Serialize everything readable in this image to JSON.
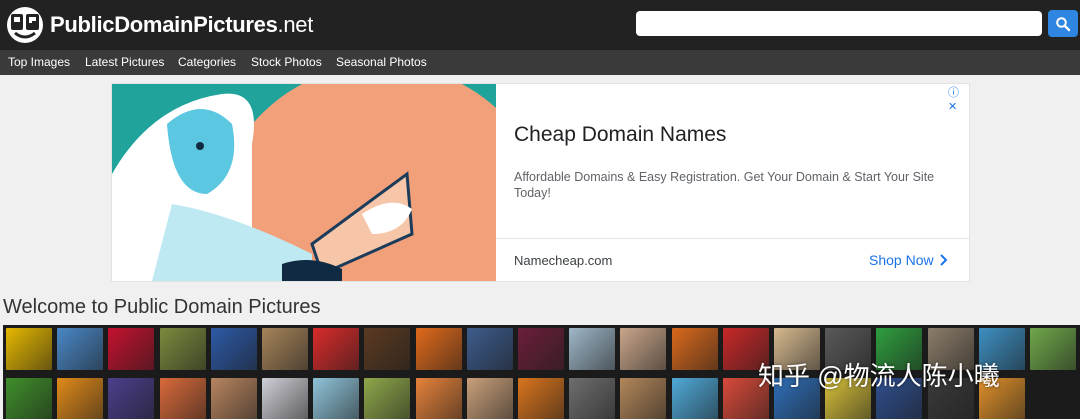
{
  "header": {
    "logo_text": "PublicDomainPictures",
    "logo_tld": ".net",
    "search_placeholder": "",
    "search_icon": "magnifier-icon"
  },
  "nav": {
    "items": [
      {
        "label": "Top Images"
      },
      {
        "label": "Latest Pictures"
      },
      {
        "label": "Categories"
      },
      {
        "label": "Stock Photos"
      },
      {
        "label": "Seasonal Photos"
      }
    ]
  },
  "ad": {
    "title": "Cheap Domain Names",
    "description": "Affordable Domains & Easy Registration. Get Your Domain & Start Your Site Today!",
    "domain": "Namecheap.com",
    "cta": "Shop Now",
    "adchoices": "ⓘ ✕"
  },
  "main": {
    "heading": "Welcome to Public Domain Pictures"
  },
  "thumbnails": [
    {
      "name": "thumb-sunburst",
      "color": "#e6b800"
    },
    {
      "name": "thumb-eye",
      "color": "#4a88c7"
    },
    {
      "name": "thumb-red-flower",
      "color": "#c4122f"
    },
    {
      "name": "thumb-giraffe",
      "color": "#7a8b3d"
    },
    {
      "name": "thumb-wind-turbine",
      "color": "#2d5aa6"
    },
    {
      "name": "thumb-wood-texture",
      "color": "#a6845a"
    },
    {
      "name": "thumb-santa-girl",
      "color": "#d92b2b"
    },
    {
      "name": "thumb-coffee-beans",
      "color": "#5b3a22"
    },
    {
      "name": "thumb-ornament",
      "color": "#e06a1b"
    },
    {
      "name": "thumb-tower-bridge",
      "color": "#3d5c8c"
    },
    {
      "name": "thumb-berries",
      "color": "#6b1f3a"
    },
    {
      "name": "thumb-ice",
      "color": "#9fb7c8"
    },
    {
      "name": "thumb-family",
      "color": "#c9a68a"
    },
    {
      "name": "thumb-butterfly",
      "color": "#d9691c"
    },
    {
      "name": "thumb-red-tulips",
      "color": "#c82828"
    },
    {
      "name": "thumb-sand",
      "color": "#d6b98f"
    },
    {
      "name": "thumb-moon",
      "color": "#5a5a5a"
    },
    {
      "name": "thumb-green-figure",
      "color": "#2f9e3e"
    },
    {
      "name": "thumb-stone-wall",
      "color": "#8c7d6a"
    },
    {
      "name": "thumb-beach",
      "color": "#3d8fc2"
    },
    {
      "name": "thumb-landscape",
      "color": "#6fa84a"
    },
    {
      "name": "thumb-grass",
      "color": "#3f8f2a"
    },
    {
      "name": "thumb-pumpkins",
      "color": "#e08a1a"
    },
    {
      "name": "thumb-lightbulb",
      "color": "#4b3f8c"
    },
    {
      "name": "thumb-pencils",
      "color": "#d96a3a"
    },
    {
      "name": "thumb-hearts",
      "color": "#b88560"
    },
    {
      "name": "thumb-keyboard",
      "color": "#cfcfd6"
    },
    {
      "name": "thumb-beach-chairs",
      "color": "#8fc3d9"
    },
    {
      "name": "thumb-deer",
      "color": "#8fa84a"
    },
    {
      "name": "thumb-peaches",
      "color": "#e6823a"
    },
    {
      "name": "thumb-woman",
      "color": "#c9a07a"
    },
    {
      "name": "thumb-autumn-tree",
      "color": "#d9741c"
    },
    {
      "name": "thumb-elephant",
      "color": "#6e6e6e"
    },
    {
      "name": "thumb-cathedral",
      "color": "#b2875a"
    },
    {
      "name": "thumb-tropical-beach",
      "color": "#4fa9d9"
    },
    {
      "name": "thumb-red-flowers-2",
      "color": "#d94a3a"
    },
    {
      "name": "thumb-blue-butterfly",
      "color": "#2f6fb8"
    },
    {
      "name": "thumb-yellow-field",
      "color": "#d6c03a"
    },
    {
      "name": "thumb-solar-panels",
      "color": "#2f4f8f"
    },
    {
      "name": "thumb-man-portrait",
      "color": "#3a3a3a"
    },
    {
      "name": "thumb-sunset",
      "color": "#e0902a"
    }
  ],
  "watermark": "知乎 @物流人陈小曦"
}
